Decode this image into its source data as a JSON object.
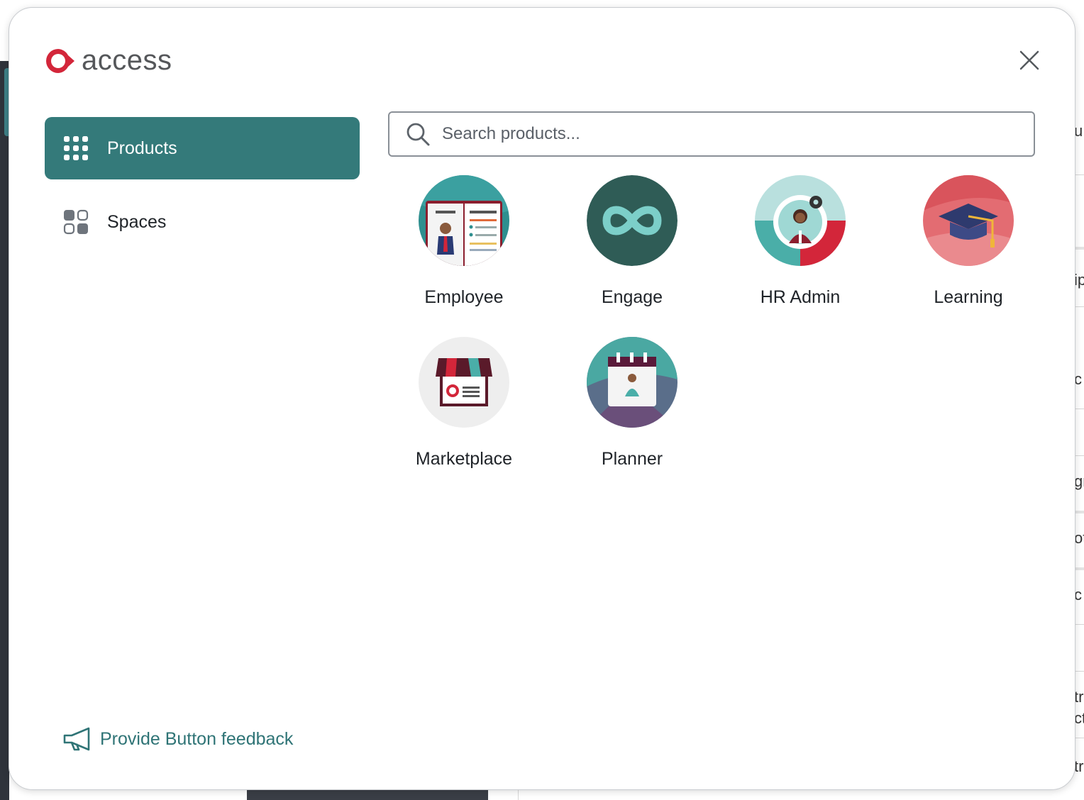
{
  "brand": {
    "name": "access",
    "color": "#d3263a"
  },
  "nav": {
    "items": [
      {
        "label": "Products",
        "icon": "grid-dots-icon",
        "active": true
      },
      {
        "label": "Spaces",
        "icon": "spaces-icon",
        "active": false
      }
    ]
  },
  "search": {
    "placeholder": "Search products...",
    "value": ""
  },
  "products": [
    {
      "label": "Employee",
      "icon": "employee-app-icon"
    },
    {
      "label": "Engage",
      "icon": "engage-app-icon"
    },
    {
      "label": "HR Admin",
      "icon": "hr-admin-app-icon"
    },
    {
      "label": "Learning",
      "icon": "learning-app-icon"
    },
    {
      "label": "Marketplace",
      "icon": "marketplace-app-icon"
    },
    {
      "label": "Planner",
      "icon": "planner-app-icon"
    }
  ],
  "feedback": {
    "label": "Provide Button feedback",
    "icon": "megaphone-icon"
  },
  "colors": {
    "accent": "#347a7a",
    "feedback_text": "#2f7476"
  },
  "background_app": {
    "edge_chars": [
      "u",
      "ip",
      "c",
      "gr",
      "ot",
      "c",
      "tr",
      "ct",
      "tr"
    ]
  }
}
